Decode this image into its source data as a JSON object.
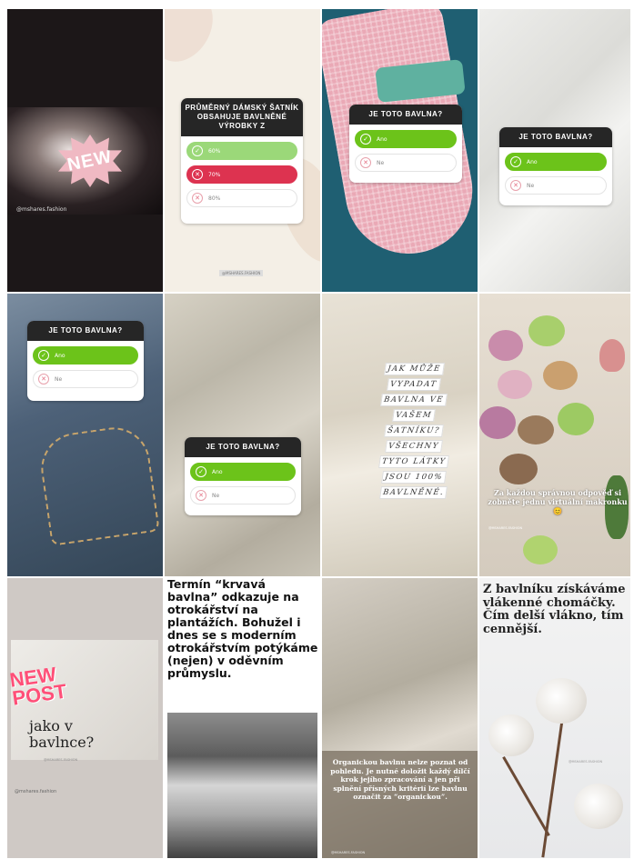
{
  "tiles": {
    "t1": {
      "badge": "NEW",
      "handle": "@mshares.fashion"
    },
    "t2": {
      "question": "PRŮMĚRNÝ DÁMSKÝ ŠATNÍK OBSAHUJE BAVLNĚNÉ VÝROBKY Z",
      "options": [
        "60%",
        "70%",
        "80%"
      ],
      "footer": "@MSHARES.FASHION"
    },
    "t3": {
      "question": "JE TOTO BAVLNA?",
      "options": [
        "Ano",
        "Ne"
      ]
    },
    "t4": {
      "question": "JE TOTO BAVLNA?",
      "options": [
        "Ano",
        "Ne"
      ]
    },
    "t5": {
      "question": "JE TOTO BAVLNA?",
      "options": [
        "Ano",
        "Ne"
      ]
    },
    "t6": {
      "question": "JE TOTO BAVLNA?",
      "options": [
        "Ano",
        "Ne"
      ]
    },
    "t7": {
      "lines": [
        "JAK MŮŽE",
        "VYPADAT",
        "BAVLNA VE",
        "VAŠEM",
        "ŠATNÍKU?",
        "VŠECHNY",
        "TYTO LÁTKY",
        "JSOU 100%",
        "BAVLNĚNÉ."
      ]
    },
    "t8": {
      "caption": "Za každou správnou odpověď si zobněte jednu virtuální makronku 😊",
      "credit": "@MSHARES.FASHION"
    },
    "t9": {
      "new_post": "NEW POST",
      "title": "jako v bavlnce?",
      "credit": "@MSHARES.FASHION",
      "handle": "@mshares.fashion"
    },
    "t10": {
      "text": "Termín “krvavá bavlna” odkazuje na otrokářství na plantážích. Bohužel i dnes se s moderním otrokářstvím potýkáme (nejen) v oděvním průmyslu."
    },
    "t11": {
      "text": "Organickou bavlnu nelze poznat od pohledu. Je nutné doložit každý dílčí krok jejího zpracování a jen při splnění přísných kritérií lze bavlnu označit za “organickou”.",
      "footer": "@MSHARES.FASHION"
    },
    "t12": {
      "text": "Z bavlníku získáváme vlákenné chomáčky. Čím delší vlákno, tím cennější.",
      "footer": "@MSHARES.FASHION"
    }
  },
  "colors": {
    "yes_green": "#6cc31a",
    "wrong_red": "#dd3350",
    "pink": "#ff4f78"
  }
}
